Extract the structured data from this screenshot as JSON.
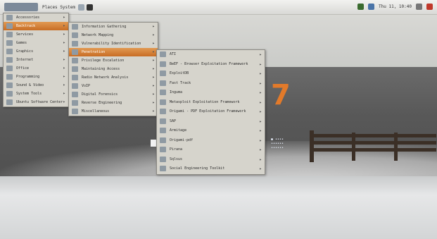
{
  "panel": {
    "places": "Places",
    "system": "System",
    "clock": "Thu 11, 10:40"
  },
  "desktop": {
    "big_number": "7"
  },
  "menu_level1": [
    {
      "label": "Accessories"
    },
    {
      "label": "Backtrack",
      "selected": true
    },
    {
      "label": "Services"
    },
    {
      "label": "Games"
    },
    {
      "label": "Graphics"
    },
    {
      "label": "Internet"
    },
    {
      "label": "Office"
    },
    {
      "label": "Programming"
    },
    {
      "label": "Sound & Video"
    },
    {
      "label": "System Tools"
    },
    {
      "label": "Ubuntu Software Center"
    }
  ],
  "menu_level2": [
    {
      "label": "Information Gathering"
    },
    {
      "label": "Network Mapping"
    },
    {
      "label": "Vulnerability Identification"
    },
    {
      "label": "Penetration",
      "selected": true
    },
    {
      "label": "Privilege Escalation"
    },
    {
      "label": "Maintaining Access"
    },
    {
      "label": "Radio Network Analysis"
    },
    {
      "label": "VoIP"
    },
    {
      "label": "Digital Forensics"
    },
    {
      "label": "Reverse Engineering"
    },
    {
      "label": "Miscellaneous"
    }
  ],
  "menu_level3": [
    {
      "label": "ATI"
    },
    {
      "label": "BeEF - Browser Exploitation Framework"
    },
    {
      "label": "ExploitDB"
    },
    {
      "label": "Fast Track"
    },
    {
      "label": "Inguma"
    },
    {
      "label": "Metasploit Exploitation Framework"
    },
    {
      "label": "Origami - PDF Exploitation Framework"
    },
    {
      "label": "SAP"
    },
    {
      "label": "Armitage"
    },
    {
      "label": "Origami-pdf"
    },
    {
      "label": "Pirana"
    },
    {
      "label": "Sqlsus"
    },
    {
      "label": "Social Engineering Toolkit"
    }
  ]
}
